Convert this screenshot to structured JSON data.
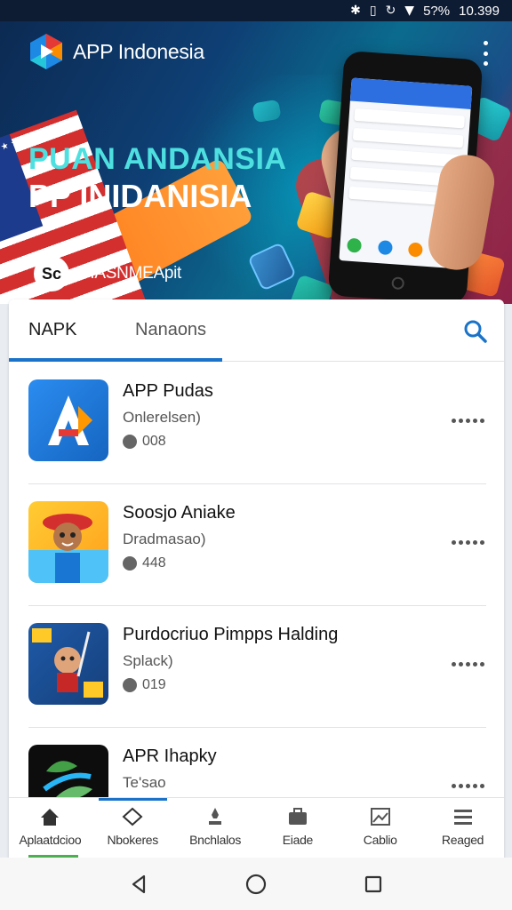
{
  "status_bar": {
    "battery": "5?%",
    "time": "10.399"
  },
  "header": {
    "app_title": "APP Indonesia"
  },
  "banner": {
    "headline_1": "PUAN ANDANSIA",
    "headline_2": "PP INIDANISIA",
    "badge_logo": "Sc",
    "badge_text": "DIASNMEApit"
  },
  "tabs": [
    {
      "label": "NAPK",
      "active": true
    },
    {
      "label": "Nanaons",
      "active": false
    }
  ],
  "apps": [
    {
      "name": "APP Pudas",
      "subtitle": "Onlerelsen)",
      "count": "008"
    },
    {
      "name": "Soosjo Aniake",
      "subtitle": "Dradmasao)",
      "count": "448"
    },
    {
      "name": "Purdocriuo Pimpps Halding",
      "subtitle": "Splack)",
      "count": "019"
    },
    {
      "name": "APR Ihapky",
      "subtitle": "Te'sao",
      "count": ""
    }
  ],
  "bottom_nav": [
    {
      "label": "Aplaatdcioo",
      "icon": "home-icon"
    },
    {
      "label": "Nbokeres",
      "icon": "diamond-icon",
      "active": true
    },
    {
      "label": "Bnchlalos",
      "icon": "rocket-icon"
    },
    {
      "label": "Eiade",
      "icon": "briefcase-icon"
    },
    {
      "label": "Cablio",
      "icon": "image-icon"
    },
    {
      "label": "Reaged",
      "icon": "list-icon"
    }
  ],
  "colors": {
    "accent": "#1a73c9",
    "banner_cyan": "#4ee0e0"
  }
}
